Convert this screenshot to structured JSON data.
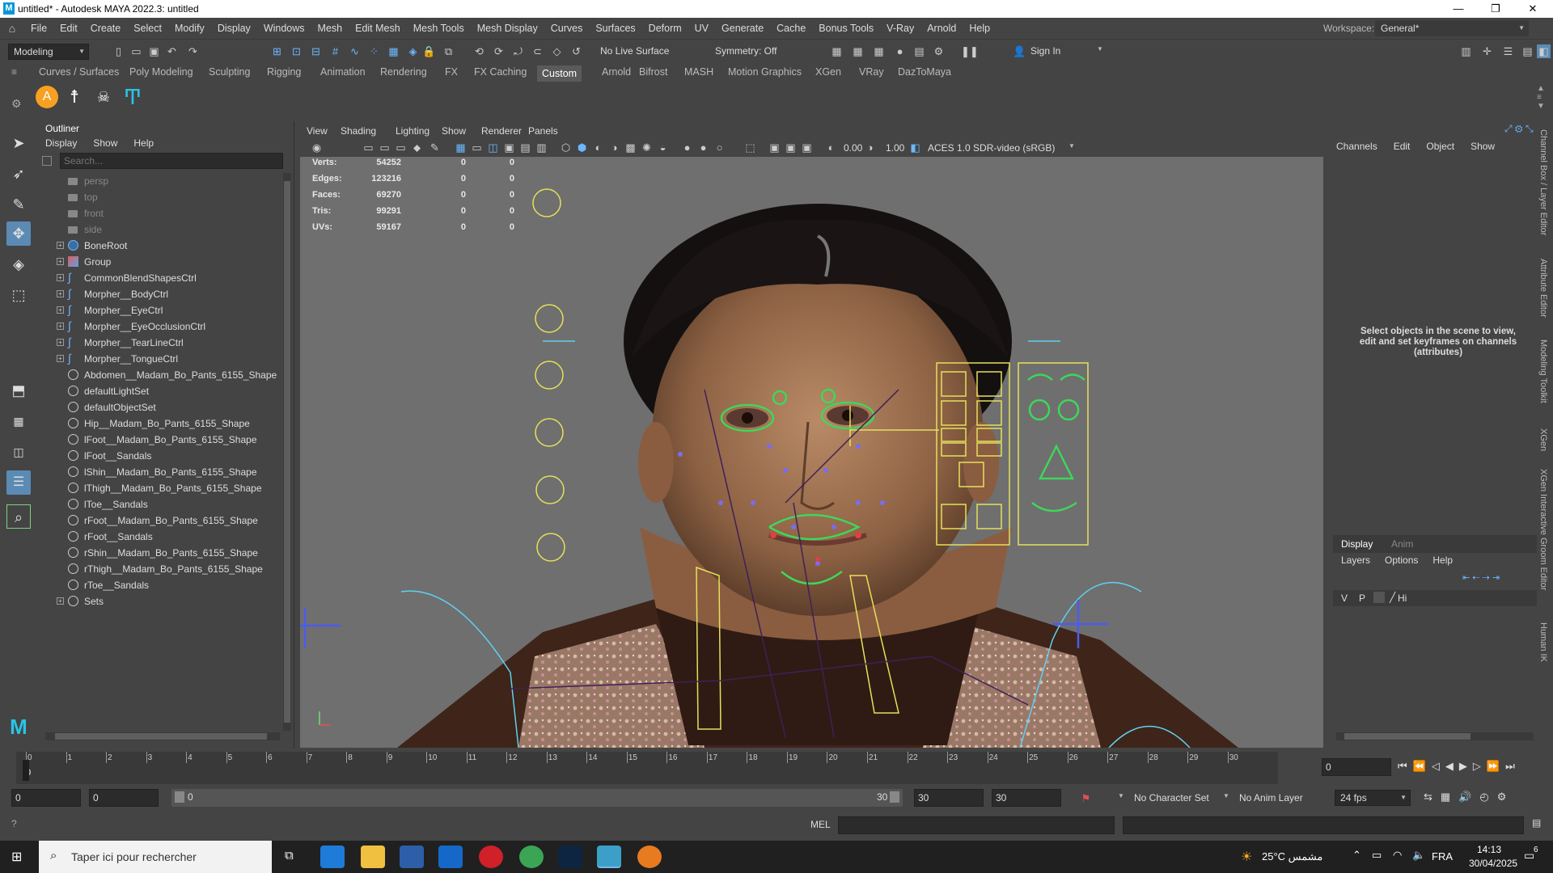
{
  "window": {
    "title": "untitled* - Autodesk MAYA 2022.3: untitled",
    "minimize": "—",
    "maximize": "❐",
    "close": "✕"
  },
  "menubar": [
    "File",
    "Edit",
    "Create",
    "Select",
    "Modify",
    "Display",
    "Windows",
    "Mesh",
    "Edit Mesh",
    "Mesh Tools",
    "Mesh Display",
    "Curves",
    "Surfaces",
    "Deform",
    "UV",
    "Generate",
    "Cache",
    "Bonus Tools",
    "V-Ray",
    "Arnold",
    "Help"
  ],
  "workspace": {
    "label": "Workspace:",
    "value": "General*"
  },
  "statusline": {
    "mode": "Modeling",
    "live_surface": "No Live Surface",
    "symmetry": "Symmetry: Off",
    "sign_in": "Sign In"
  },
  "shelf_tabs": [
    "Curves / Surfaces",
    "Poly Modeling",
    "Sculpting",
    "Rigging",
    "Animation",
    "Rendering",
    "FX",
    "FX Caching",
    "Custom",
    "Arnold",
    "Bifrost",
    "MASH",
    "Motion Graphics",
    "XGen",
    "VRay",
    "DazToMaya"
  ],
  "shelf_active": "Custom",
  "outliner": {
    "title": "Outliner",
    "menu": [
      "Display",
      "Show",
      "Help"
    ],
    "search_placeholder": "Search...",
    "items": [
      {
        "label": "persp",
        "kind": "cam"
      },
      {
        "label": "top",
        "kind": "cam"
      },
      {
        "label": "front",
        "kind": "cam"
      },
      {
        "label": "side",
        "kind": "cam"
      },
      {
        "label": "BoneRoot",
        "kind": "joint",
        "expand": true
      },
      {
        "label": "Group",
        "kind": "group",
        "expand": true
      },
      {
        "label": "CommonBlendShapesCtrl",
        "kind": "curve",
        "expand": true
      },
      {
        "label": "Morpher__BodyCtrl",
        "kind": "curve",
        "expand": true
      },
      {
        "label": "Morpher__EyeCtrl",
        "kind": "curve",
        "expand": true
      },
      {
        "label": "Morpher__EyeOcclusionCtrl",
        "kind": "curve",
        "expand": true
      },
      {
        "label": "Morpher__TearLineCtrl",
        "kind": "curve",
        "expand": true
      },
      {
        "label": "Morpher__TongueCtrl",
        "kind": "curve",
        "expand": true
      },
      {
        "label": "Abdomen__Madam_Bo_Pants_6155_Shape",
        "kind": "set"
      },
      {
        "label": "defaultLightSet",
        "kind": "set"
      },
      {
        "label": "defaultObjectSet",
        "kind": "set"
      },
      {
        "label": "Hip__Madam_Bo_Pants_6155_Shape",
        "kind": "set"
      },
      {
        "label": "lFoot__Madam_Bo_Pants_6155_Shape",
        "kind": "set"
      },
      {
        "label": "lFoot__Sandals",
        "kind": "set"
      },
      {
        "label": "lShin__Madam_Bo_Pants_6155_Shape",
        "kind": "set"
      },
      {
        "label": "lThigh__Madam_Bo_Pants_6155_Shape",
        "kind": "set"
      },
      {
        "label": "lToe__Sandals",
        "kind": "set"
      },
      {
        "label": "rFoot__Madam_Bo_Pants_6155_Shape",
        "kind": "set"
      },
      {
        "label": "rFoot__Sandals",
        "kind": "set"
      },
      {
        "label": "rShin__Madam_Bo_Pants_6155_Shape",
        "kind": "set"
      },
      {
        "label": "rThigh__Madam_Bo_Pants_6155_Shape",
        "kind": "set"
      },
      {
        "label": "rToe__Sandals",
        "kind": "set"
      },
      {
        "label": "Sets",
        "kind": "set",
        "expand": true
      }
    ]
  },
  "viewport": {
    "menu": [
      "View",
      "Shading",
      "Lighting",
      "Show",
      "Renderer",
      "Panels"
    ],
    "exposure": "0.00",
    "gamma": "1.00",
    "color_space": "ACES 1.0 SDR-video (sRGB)",
    "hud": [
      {
        "label": "Verts:",
        "a": "54252",
        "b": "0",
        "c": "0"
      },
      {
        "label": "Edges:",
        "a": "123216",
        "b": "0",
        "c": "0"
      },
      {
        "label": "Faces:",
        "a": "69270",
        "b": "0",
        "c": "0"
      },
      {
        "label": "Tris:",
        "a": "99291",
        "b": "0",
        "c": "0"
      },
      {
        "label": "UVs:",
        "a": "59167",
        "b": "0",
        "c": "0"
      }
    ]
  },
  "channelbox": {
    "menu": [
      "Channels",
      "Edit",
      "Object",
      "Show"
    ],
    "hint": "Select objects in the scene to view, edit and set keyframes on channels (attributes)",
    "tabs": [
      "Display",
      "Anim"
    ],
    "layer_menu": [
      "Layers",
      "Options",
      "Help"
    ],
    "layer_cols": [
      "V",
      "P",
      "Hi"
    ]
  },
  "right_strip": [
    "Channel Box / Layer Editor",
    "Attribute Editor",
    "Modeling Toolkit",
    "XGen",
    "XGen Interactive Groom Editor",
    "Human IK"
  ],
  "timeline": {
    "ticks": [
      "0",
      "1",
      "2",
      "3",
      "4",
      "5",
      "6",
      "7",
      "8",
      "9",
      "10",
      "11",
      "12",
      "13",
      "14",
      "15",
      "16",
      "17",
      "18",
      "19",
      "20",
      "21",
      "22",
      "23",
      "24",
      "25",
      "26",
      "27",
      "28",
      "29",
      "30"
    ],
    "current_frame": "0",
    "current_marker": "0"
  },
  "range": {
    "start": "0",
    "playback_start": "0",
    "slider_start": "0",
    "slider_end": "30",
    "playback_end": "30",
    "end": "30",
    "character_set": "No Character Set",
    "anim_layer": "No Anim Layer",
    "fps": "24 fps"
  },
  "cmdline": {
    "lang": "MEL"
  },
  "taskbar": {
    "search_placeholder": "Taper ici pour rechercher",
    "weather": "25°C مشمس",
    "lang": "FRA",
    "time": "14:13",
    "date": "30/04/2025",
    "notif": "6"
  }
}
